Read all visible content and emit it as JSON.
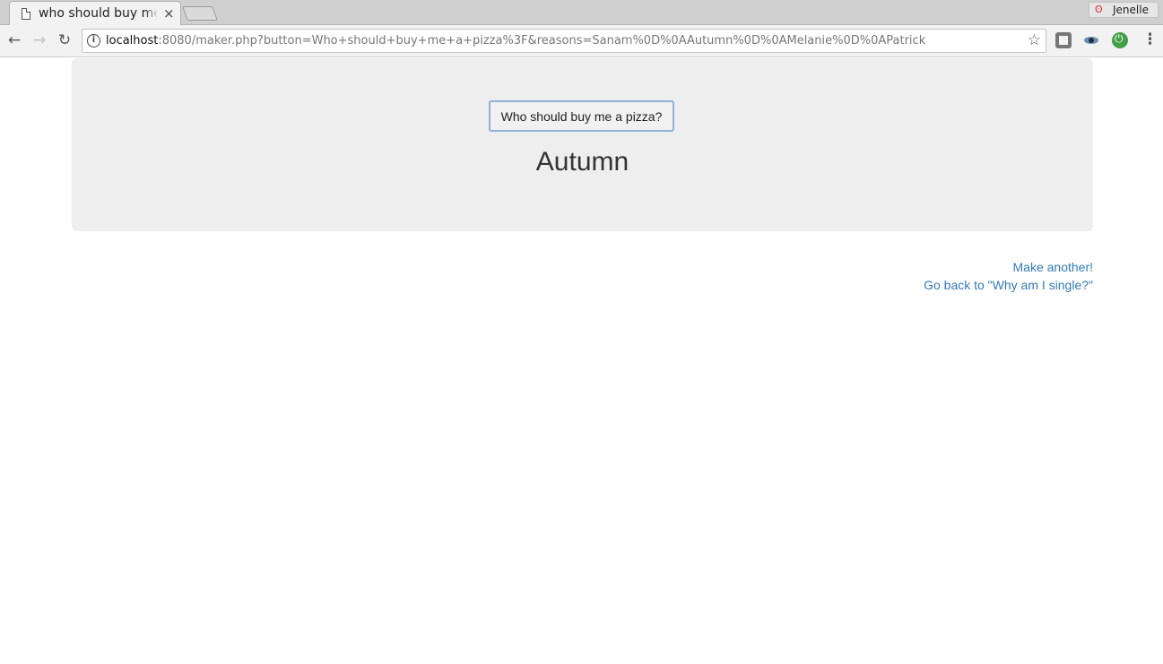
{
  "browser": {
    "tab_title": "who should buy me",
    "tab_close": "×",
    "profile_name": "Jenelle",
    "url_host": "localhost",
    "url_rest": ":8080/maker.php?button=Who+should+buy+me+a+pizza%3F&reasons=Sanam%0D%0AAutumn%0D%0AMelanie%0D%0APatrick",
    "back_glyph": "←",
    "forward_glyph": "→",
    "reload_glyph": "↻",
    "info_glyph": "i",
    "star_glyph": "☆",
    "menu_glyph": "⋮",
    "profile_glyph": "ʘ"
  },
  "page": {
    "button_label": "Who should buy me a pizza?",
    "result": "Autumn",
    "links": {
      "make_another": "Make another!",
      "go_back": "Go back to \"Why am I single?\""
    }
  },
  "colors": {
    "link": "#337ab7",
    "jumbotron_bg": "#eeeeee",
    "button_border": "#8fb0d9"
  }
}
